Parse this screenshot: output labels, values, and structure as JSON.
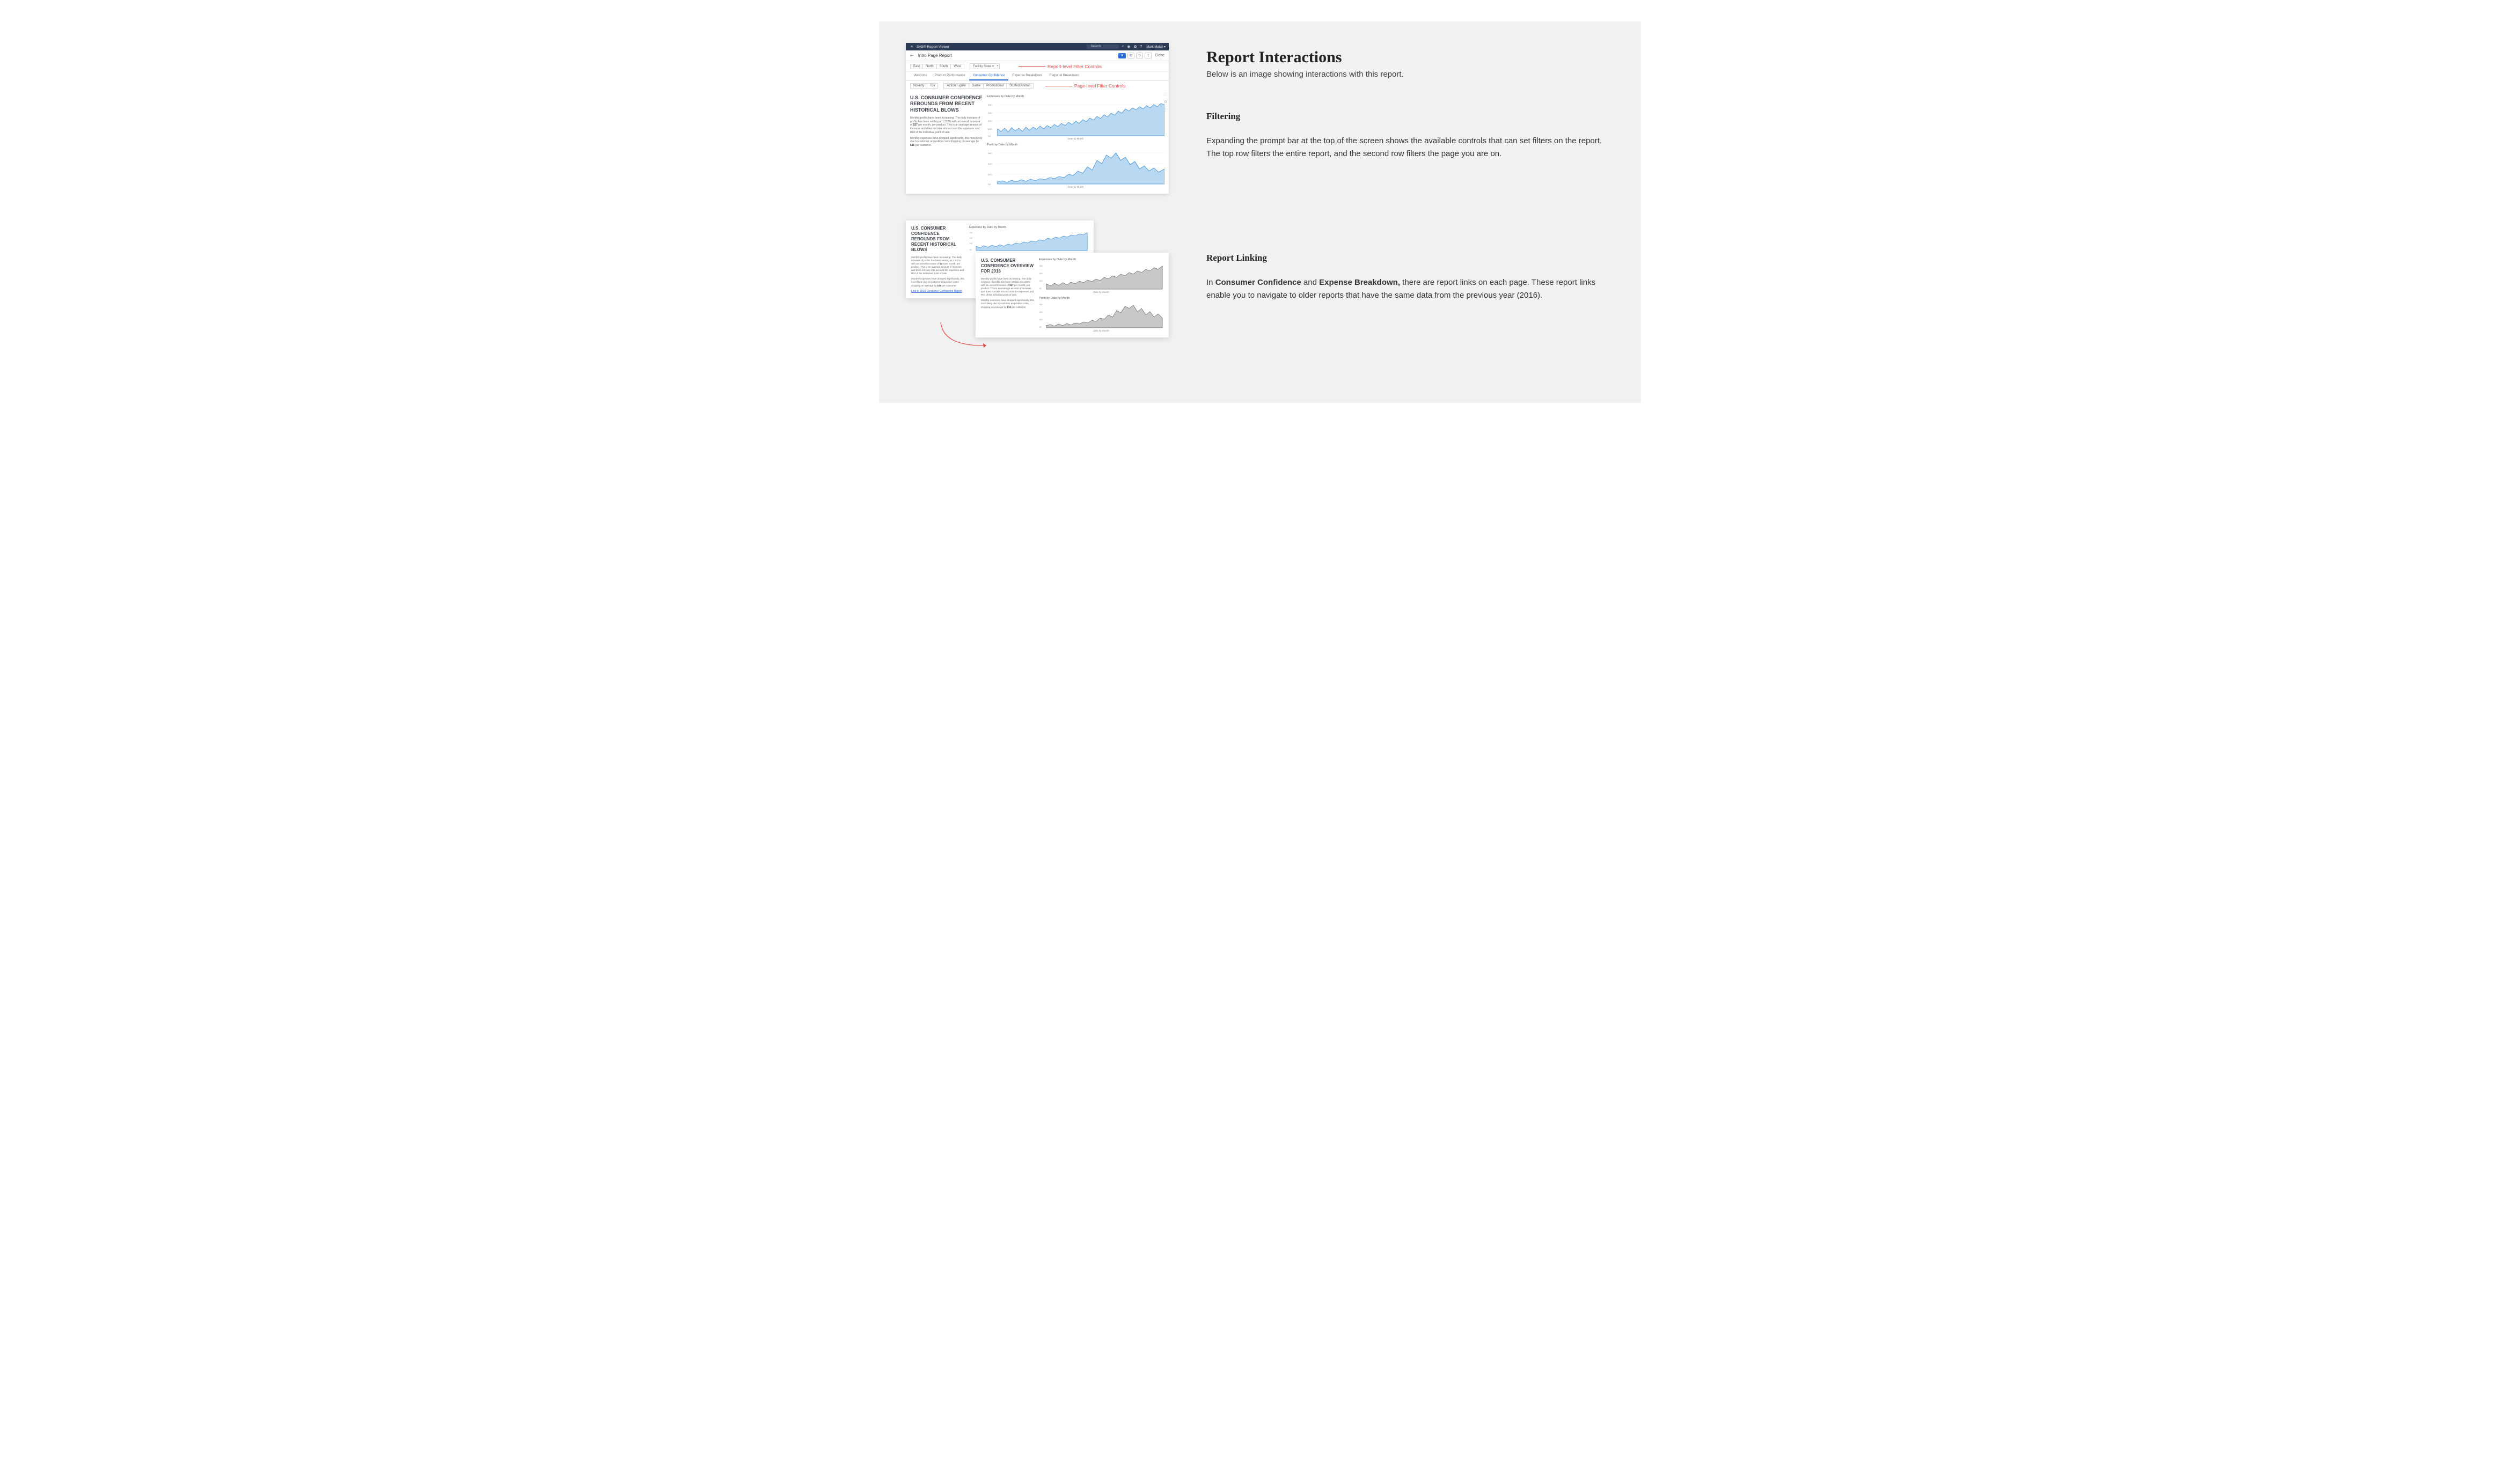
{
  "heading": "Report Interactions",
  "subtitle": "Below is an image showing interactions with this report.",
  "section1": {
    "title": "Filtering",
    "body": "Expanding the prompt bar at the top of the screen shows the available controls that can set filters on the report. The top row filters the entire report, and the second row filters the page you are on."
  },
  "section2": {
    "title": "Report Linking",
    "body_pre": "In ",
    "body_b1": "Consumer Confidence",
    "body_mid": " and ",
    "body_b2": "Expense Breakdown,",
    "body_post": " there are report links on each page. These report links enable you to navigate to older reports that have the same data from the previous year (2016)."
  },
  "viewer": {
    "brand": "SAS® Report Viewer",
    "search_placeholder": "Search",
    "user": "Mark Malak ▾",
    "report_title": "Intro Page Report",
    "close": "Close",
    "region_chips": [
      "East",
      "North",
      "South",
      "West"
    ],
    "state_filter": "Facility State    ▾",
    "tabs": [
      "Welcome",
      "Product Performance",
      "Consumer Confidence",
      "Expense Breakdown",
      "Regional Breakdown"
    ],
    "active_tab": "Consumer Confidence",
    "page_chips_a": [
      "Novelty",
      "Toy"
    ],
    "page_chips_b": [
      "Action Figure",
      "Game",
      "Promotional",
      "Stuffed Animal"
    ],
    "annot_report": "Report-level Filter Controls",
    "annot_page": "Page-level Filter Controls",
    "story": {
      "title": "U.S. CONSUMER CONFIDENCE REBOUNDS FROM RECENT HISTORICAL BLOWS",
      "p1_pre": "Monthly profits have been increasing. The daily increase of profits has been settling at 1.332% with an overall increase of ",
      "p1_b": "$27",
      "p1_post": " per month, per product. This is an average amount of increase and does not take into account the expenses and ROI of the individual point of sale.",
      "p2_pre": "Monthly expenses have dropped significantly, this most likely due to customer acquisition costs dropping on average by ",
      "p2_b": "$16",
      "p2_post": " per customer."
    },
    "chart1_title": "Expenses by Date by Month",
    "chart2_title": "Profit by Date by Month",
    "chart_xlabel": "Date by Month",
    "y_expenses": [
      "$50",
      "$40",
      "$30",
      "$20",
      "$10",
      "$0"
    ],
    "y_profit": [
      "$60",
      "$40",
      "$20",
      "$0"
    ]
  },
  "linking": {
    "cardA_title": "U.S. CONSUMER CONFIDENCE REBOUNDS FROM RECENT HISTORICAL BLOWS",
    "cardB_title": "U.S. CONSUMER CONFIDENCE OVERVIEW FOR 2016",
    "link_text": "Link to 2016 Consumer Confidence Report",
    "chart1_title": "Expenses by Date by Month",
    "chart2_title": "Profit by Date by Month",
    "chart_xlabel": "Date by Month"
  },
  "chart_data": [
    {
      "type": "area",
      "name": "Expenses by Date by Month (blue)",
      "ylim": [
        0,
        50
      ],
      "ylabel": "$",
      "xlabel": "Date by Month",
      "values": [
        11,
        8,
        12,
        7,
        13,
        9,
        12,
        8,
        14,
        9,
        13,
        10,
        14,
        10,
        15,
        11,
        16,
        12,
        17,
        13,
        18,
        14,
        20,
        15,
        22,
        17,
        24,
        19,
        26,
        21,
        28,
        23,
        30,
        25,
        33,
        28,
        36,
        30,
        38,
        33,
        40,
        35,
        42,
        37,
        44,
        40,
        46
      ]
    },
    {
      "type": "area",
      "name": "Profit by Date by Month (blue)",
      "ylim": [
        0,
        60
      ],
      "ylabel": "$",
      "xlabel": "Date by Month",
      "values": [
        4,
        6,
        3,
        7,
        4,
        8,
        5,
        9,
        6,
        8,
        5,
        9,
        6,
        10,
        7,
        12,
        9,
        14,
        11,
        16,
        13,
        20,
        17,
        26,
        22,
        34,
        30,
        44,
        40,
        52,
        48,
        56,
        45,
        50,
        38,
        46,
        34,
        42,
        30,
        38,
        28,
        36,
        26,
        34,
        30,
        36,
        32
      ]
    }
  ]
}
